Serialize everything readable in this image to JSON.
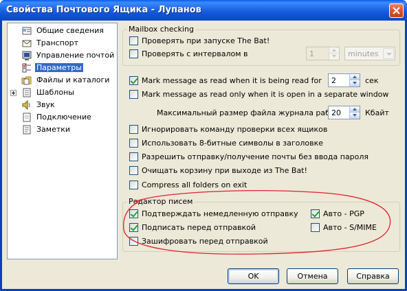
{
  "window": {
    "title": "Свойства Почтового Ящика - Лупанов"
  },
  "tree": {
    "items": [
      {
        "label": "Общие сведения",
        "icon": "general-info-icon",
        "selected": false,
        "expandable": false
      },
      {
        "label": "Транспорт",
        "icon": "transport-icon",
        "selected": false,
        "expandable": false
      },
      {
        "label": "Управление почтой",
        "icon": "mail-management-icon",
        "selected": false,
        "expandable": false
      },
      {
        "label": "Параметры",
        "icon": "parameters-icon",
        "selected": true,
        "expandable": false
      },
      {
        "label": "Файлы и каталоги",
        "icon": "files-folders-icon",
        "selected": false,
        "expandable": false
      },
      {
        "label": "Шаблоны",
        "icon": "templates-icon",
        "selected": false,
        "expandable": true
      },
      {
        "label": "Звук",
        "icon": "sound-icon",
        "selected": false,
        "expandable": false
      },
      {
        "label": "Подключение",
        "icon": "connection-icon",
        "selected": false,
        "expandable": false
      },
      {
        "label": "Заметки",
        "icon": "notes-icon",
        "selected": false,
        "expandable": false
      }
    ]
  },
  "mailbox_checking": {
    "title": "Mailbox checking",
    "check_on_start": {
      "label": "Проверять при запуске The Bat!",
      "checked": false
    },
    "check_interval": {
      "label": "Проверять с интервалом в",
      "checked": false
    },
    "interval_value": "1",
    "interval_unit": "minutes"
  },
  "options": {
    "mark_read_while_read": {
      "label": "Mark message as read when it is being read for",
      "checked": true
    },
    "mark_read_seconds": "2",
    "seconds_unit": "сек",
    "mark_read_only_separate": {
      "label": "Mark message as read only when it is open in a separate window",
      "checked": false
    },
    "max_log_size_label": "Максимальный размер файла журнала работы:",
    "max_log_size_value": "20",
    "max_log_size_unit": "Кбайт",
    "ignore_check_all": {
      "label": "Игнорировать команду проверки всех ящиков",
      "checked": false
    },
    "use_8bit": {
      "label": "Использовать 8-битные символы в заголовке",
      "checked": false
    },
    "allow_send_without_password": {
      "label": "Разрешить отправку/получение почты без ввода пароля",
      "checked": false
    },
    "empty_trash_on_exit": {
      "label": "Очищать корзину при выходе из The Bat!",
      "checked": false
    },
    "compress_all_folders": {
      "label": "Compress all folders on exit",
      "checked": false
    }
  },
  "editor": {
    "title": "Редактор писем",
    "confirm_immediate_send": {
      "label": "Подтверждать немедленную отправку",
      "checked": true
    },
    "sign_before_send": {
      "label": "Подписать перед отправкой",
      "checked": true
    },
    "encrypt_before_send": {
      "label": "Зашифровать перед отправкой",
      "checked": false
    },
    "auto_pgp": {
      "label": "Авто - PGP",
      "checked": true
    },
    "auto_smime": {
      "label": "Авто - S/MIME",
      "checked": false
    }
  },
  "buttons": {
    "ok": "OK",
    "cancel": "Отмена",
    "help": "Справка"
  },
  "colors": {
    "titlebar": "#0a5ee8",
    "dialog_bg": "#ece9d8",
    "selection": "#316ac5",
    "annotation_ellipse": "#e0202a"
  }
}
